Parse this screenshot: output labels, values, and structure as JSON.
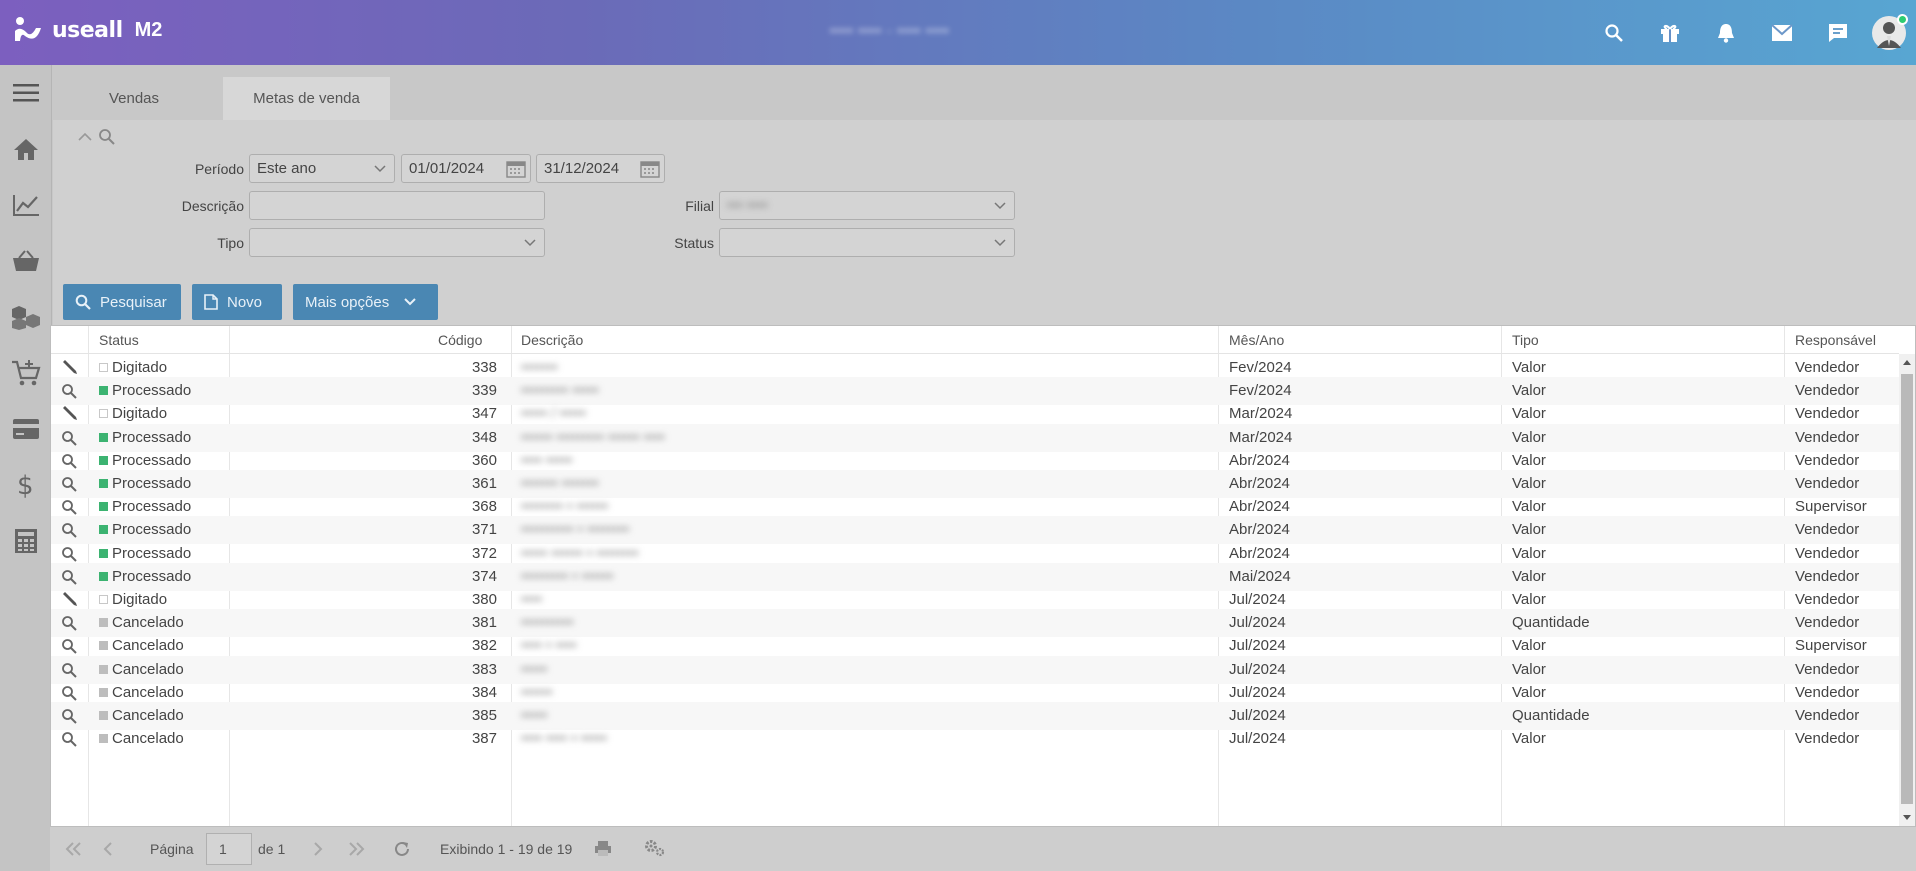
{
  "app": {
    "logo_text": "useall",
    "version": "M2",
    "center_text": "•••• ••••  -  •••• ••••"
  },
  "top_icons": [
    "search-icon",
    "gift-icon",
    "bell-icon",
    "mail-icon",
    "chat-icon",
    "user-avatar"
  ],
  "sidebar": [
    "menu-icon",
    "home-icon",
    "chart-icon",
    "basket-icon",
    "boxes-icon",
    "cart-add-icon",
    "credit-card-icon",
    "dollar-icon",
    "calculator-icon"
  ],
  "tabs": [
    {
      "label": "Vendas"
    },
    {
      "label": "Metas de venda"
    }
  ],
  "filters": {
    "periodo_label": "Período",
    "periodo_value": "Este ano",
    "date_from": "01/01/2024",
    "date_to": "31/12/2024",
    "descricao_label": "Descrição",
    "descricao_value": "",
    "tipo_label": "Tipo",
    "tipo_value": "",
    "filial_label": "Filial",
    "filial_value": "••• ••••",
    "status_label": "Status",
    "status_value": ""
  },
  "buttons": {
    "search": "Pesquisar",
    "new": "Novo",
    "more": "Mais opções"
  },
  "grid": {
    "columns": [
      "Status",
      "Código",
      "Descrição",
      "Mês/Ano",
      "Tipo",
      "Responsável"
    ],
    "rows": [
      {
        "icon": "pencil",
        "status": "Digitado",
        "code": "338",
        "desc": "•••••••",
        "month": "Fev/2024",
        "type": "Valor",
        "resp": "Vendedor"
      },
      {
        "icon": "search",
        "status": "Processado",
        "code": "339",
        "desc": "••••••••• •••••",
        "month": "Fev/2024",
        "type": "Valor",
        "resp": "Vendedor"
      },
      {
        "icon": "pencil",
        "status": "Digitado",
        "code": "347",
        "desc": "••••• / •••••",
        "month": "Mar/2024",
        "type": "Valor",
        "resp": "Vendedor"
      },
      {
        "icon": "search",
        "status": "Processado",
        "code": "348",
        "desc": "•••••• ••••••••• •••••• ••••",
        "month": "Mar/2024",
        "type": "Valor",
        "resp": "Vendedor"
      },
      {
        "icon": "search",
        "status": "Processado",
        "code": "360",
        "desc": "•••• •••••",
        "month": "Abr/2024",
        "type": "Valor",
        "resp": "Vendedor"
      },
      {
        "icon": "search",
        "status": "Processado",
        "code": "361",
        "desc": "••••••• •••••••",
        "month": "Abr/2024",
        "type": "Valor",
        "resp": "Vendedor"
      },
      {
        "icon": "search",
        "status": "Processado",
        "code": "368",
        "desc": "•••••••• • ••••••",
        "month": "Abr/2024",
        "type": "Valor",
        "resp": "Supervisor"
      },
      {
        "icon": "search",
        "status": "Processado",
        "code": "371",
        "desc": "•••••••••• • ••••••••",
        "month": "Abr/2024",
        "type": "Valor",
        "resp": "Vendedor"
      },
      {
        "icon": "search",
        "status": "Processado",
        "code": "372",
        "desc": "••••• •••••• • ••••••••",
        "month": "Abr/2024",
        "type": "Valor",
        "resp": "Vendedor"
      },
      {
        "icon": "search",
        "status": "Processado",
        "code": "374",
        "desc": "••••••••• • ••••••",
        "month": "Mai/2024",
        "type": "Valor",
        "resp": "Vendedor"
      },
      {
        "icon": "pencil",
        "status": "Digitado",
        "code": "380",
        "desc": "••••",
        "month": "Jul/2024",
        "type": "Valor",
        "resp": "Vendedor"
      },
      {
        "icon": "search",
        "status": "Cancelado",
        "code": "381",
        "desc": "••••••••••",
        "month": "Jul/2024",
        "type": "Quantidade",
        "resp": "Vendedor"
      },
      {
        "icon": "search",
        "status": "Cancelado",
        "code": "382",
        "desc": "•••• • ••••",
        "month": "Jul/2024",
        "type": "Valor",
        "resp": "Supervisor"
      },
      {
        "icon": "search",
        "status": "Cancelado",
        "code": "383",
        "desc": "•••••",
        "month": "Jul/2024",
        "type": "Valor",
        "resp": "Vendedor"
      },
      {
        "icon": "search",
        "status": "Cancelado",
        "code": "384",
        "desc": "••••••",
        "month": "Jul/2024",
        "type": "Valor",
        "resp": "Vendedor"
      },
      {
        "icon": "search",
        "status": "Cancelado",
        "code": "385",
        "desc": "•••••",
        "month": "Jul/2024",
        "type": "Quantidade",
        "resp": "Vendedor"
      },
      {
        "icon": "search",
        "status": "Cancelado",
        "code": "387",
        "desc": "•••• •••• • •••••",
        "month": "Jul/2024",
        "type": "Valor",
        "resp": "Vendedor"
      }
    ]
  },
  "pagination": {
    "page_label": "Página",
    "page_value": "1",
    "of_label": "de 1",
    "showing": "Exibindo 1 - 19 de 19"
  },
  "colors": {
    "top_gradient_start": "#7c5fbf",
    "top_gradient_end": "#58a6d2",
    "button": "#4a87b3",
    "processed": "#3cb371",
    "cancelled": "#bdbdbd"
  }
}
